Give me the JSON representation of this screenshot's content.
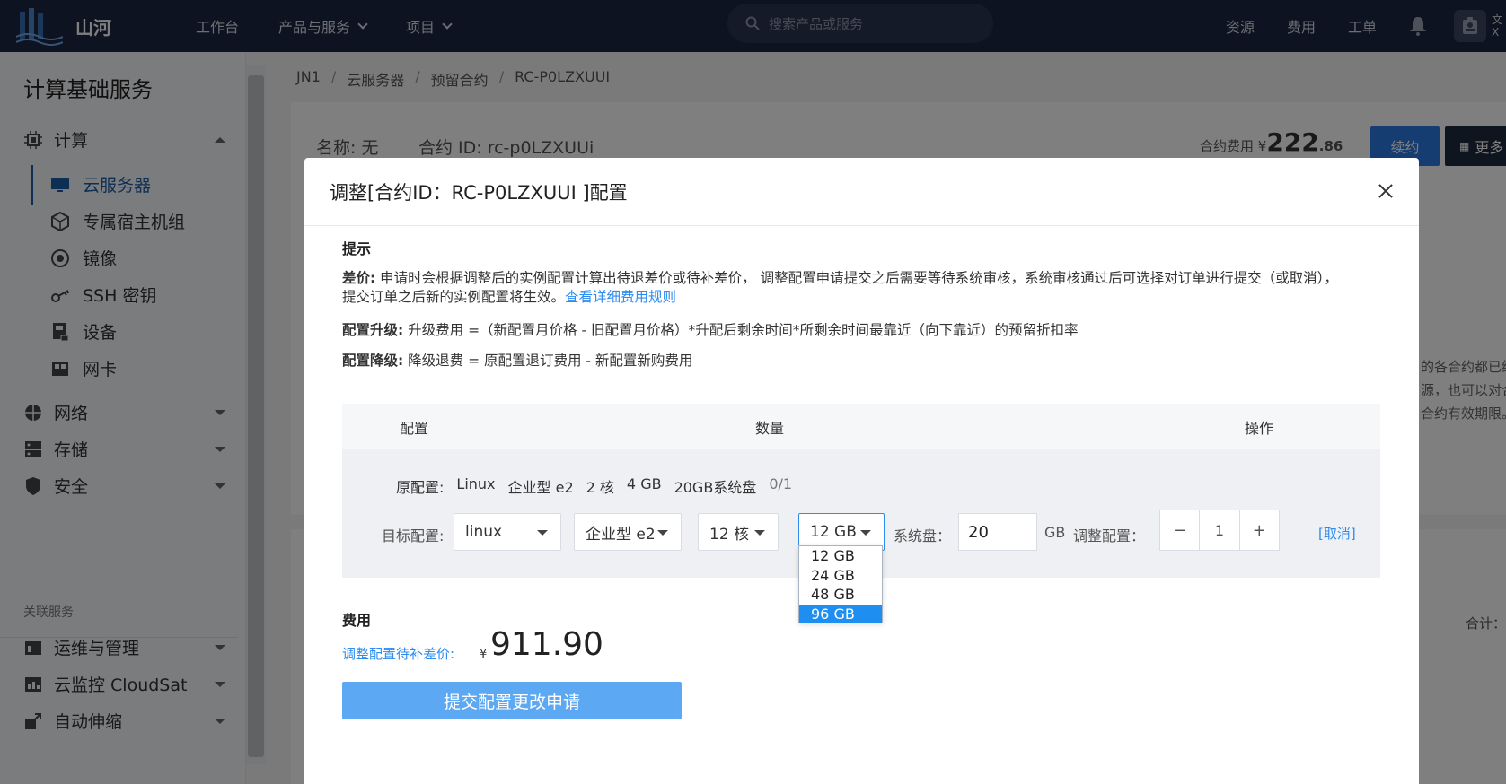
{
  "topbar": {
    "logo_text": "山河",
    "nav": [
      {
        "label": "工作台",
        "has_menu": false
      },
      {
        "label": "产品与服务",
        "has_menu": true
      },
      {
        "label": "项目",
        "has_menu": true
      }
    ],
    "search_placeholder": "搜索产品或服务",
    "right_links": [
      "资源",
      "费用",
      "工单"
    ],
    "truncated_user": "文\nX",
    "bg_color": "#1a2740"
  },
  "sidebar": {
    "title": "计算基础服务",
    "groups": {
      "compute": "计算",
      "network": "网络",
      "storage": "存储",
      "security": "安全"
    },
    "items": [
      {
        "label": "云服务器",
        "icon": "monitor-icon",
        "active": true
      },
      {
        "label": "专属宿主机组",
        "icon": "cube-icon",
        "active": false
      },
      {
        "label": "镜像",
        "icon": "disc-icon",
        "active": false
      },
      {
        "label": "SSH 密钥",
        "icon": "key-icon",
        "active": false
      },
      {
        "label": "设备",
        "icon": "device-icon",
        "active": false
      },
      {
        "label": "网卡",
        "icon": "nic-icon",
        "active": false
      }
    ],
    "related_label": "关联服务",
    "related": [
      {
        "label": "运维与管理"
      },
      {
        "label": "云监控 CloudSat"
      },
      {
        "label": "自动伸缩"
      }
    ]
  },
  "breadcrumb": [
    "JN1",
    "云服务器",
    "预留合约",
    "RC-P0LZXUUI"
  ],
  "contract": {
    "name": "名称: 无",
    "id": "合约 ID: rc-p0LZXUUi",
    "fee_label": "合约费用 ¥",
    "fee_int": "222",
    "fee_dec": ".86",
    "renew": "续约",
    "more": "更多",
    "right_texts": [
      "的各合约都已终",
      "源，也可以对合",
      "合约有效期限。"
    ],
    "total": "合计："
  },
  "modal": {
    "title": "调整[合约ID：RC-P0LZXUUI ]配置",
    "tip_title": "提示",
    "tips": {
      "diff_label": "差价:",
      "diff_text": "申请时会根据调整后的实例配置计算出待退差价或待补差价， 调整配置申请提交之后需要等待系统审核，系统审核通过后可选择对订单进行提交（或取消），提交订单之后新的实例配置将生效。",
      "diff_link": "查看详细费用规则",
      "up_label": "配置升级:",
      "up_text": "升级费用 =（新配置月价格 - 旧配置月价格）*升配后剩余时间*所剩余时间最靠近（向下靠近）的预留折扣率",
      "down_label": "配置降级:",
      "down_text": "降级退费 = 原配置退订费用 - 新配置新购费用"
    },
    "table_head": {
      "config": "配置",
      "quantity": "数量",
      "action": "操作"
    },
    "original": {
      "label": "原配置:",
      "os": "Linux",
      "type": "企业型 e2",
      "cpu": "2 核",
      "mem": "4 GB",
      "disk": "20GB系统盘",
      "count": "0/1"
    },
    "target": {
      "label": "目标配置:",
      "os": "linux",
      "type": "企业型 e2",
      "cpu": "12 核",
      "mem": "12 GB",
      "disk_label": "系统盘：",
      "disk_value": "20",
      "disk_unit": "GB",
      "adjust_label": "调整配置：",
      "minus": "−",
      "qty": "1",
      "plus": "+",
      "cancel": "[取消]"
    },
    "mem_options": [
      "12 GB",
      "24 GB",
      "48 GB",
      "96 GB"
    ],
    "mem_highlighted_index": 3,
    "fee": {
      "title": "费用",
      "label": "调整配置待补差价:",
      "currency": "¥",
      "amount": "911.90"
    },
    "submit": "提交配置更改申请"
  },
  "colors": {
    "accent": "#2d8cf0",
    "submit": "#5ca8f2",
    "option_highlight": "#1e8ff0"
  }
}
